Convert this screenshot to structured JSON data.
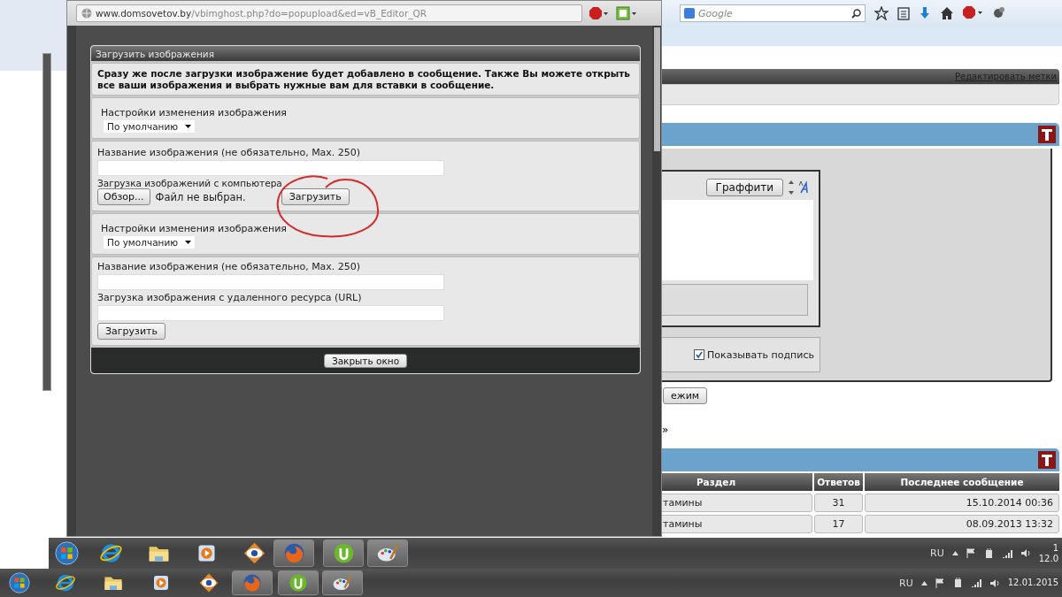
{
  "browser": {
    "search_placeholder": "Google"
  },
  "popup": {
    "url_host": "www.domsovetov.by",
    "url_path": "/vbimghost.php?do=popupload&ed=vB_Editor_QR",
    "title": "Загрузить изображения",
    "intro": "Сразу же после загрузки изображение будет добавлено в сообщение. Также Вы можете открыть все ваши изображения и выбрать нужные вам для вставки в сообщение.",
    "sections": [
      {
        "kind": "resize",
        "label": "Настройки изменения изображения",
        "value": "По умолчанию"
      },
      {
        "kind": "file",
        "name_label": "Название изображения (не обязательно, Max. 250)",
        "file_label": "Загрузка изображений с компьютера",
        "browse": "Обзор...",
        "no_file": "Файл не выбран.",
        "submit": "Загрузить"
      },
      {
        "kind": "resize",
        "label": "Настройки изменения изображения",
        "value": "По умолчанию"
      },
      {
        "kind": "url",
        "name_label": "Название изображения (не обязательно, Max. 250)",
        "url_label": "Загрузка изображения с удаленного ресурса (URL)",
        "submit": "Загрузить"
      }
    ],
    "close": "Закрыть окно"
  },
  "page": {
    "edit_tags": "Редактировать метки",
    "graffiti": "Граффити",
    "signature": {
      "label": "Показывать подпись",
      "checked": true
    },
    "mode_button": "ежим",
    "breadcrumb": "»",
    "table": {
      "columns": [
        "Раздел",
        "Ответов",
        "Последнее сообщение"
      ],
      "rows": [
        [
          "тамины",
          "31",
          "15.10.2014 00:36"
        ],
        [
          "тамины",
          "17",
          "08.09.2013 13:32"
        ]
      ]
    }
  },
  "taskbars": [
    {
      "apps": [
        {
          "kind": "orb",
          "running": false
        },
        {
          "kind": "ie",
          "running": false
        },
        {
          "kind": "folder",
          "running": false
        },
        {
          "kind": "media",
          "running": false
        },
        {
          "kind": "eye",
          "running": false
        },
        {
          "kind": "firefox",
          "running": true
        },
        {
          "kind": "torrent",
          "running": true
        },
        {
          "kind": "palette",
          "running": true
        }
      ],
      "lang": "RU",
      "clock": [
        "1",
        "12.0"
      ]
    },
    {
      "apps": [
        {
          "kind": "orb",
          "running": false
        },
        {
          "kind": "ie",
          "running": false
        },
        {
          "kind": "folder",
          "running": false
        },
        {
          "kind": "media",
          "running": false
        },
        {
          "kind": "eye",
          "running": false
        },
        {
          "kind": "firefox",
          "running": true
        },
        {
          "kind": "torrent",
          "running": true
        },
        {
          "kind": "palette",
          "running": true
        }
      ],
      "lang": "RU",
      "clock": [
        "12.01.2015"
      ]
    }
  ]
}
